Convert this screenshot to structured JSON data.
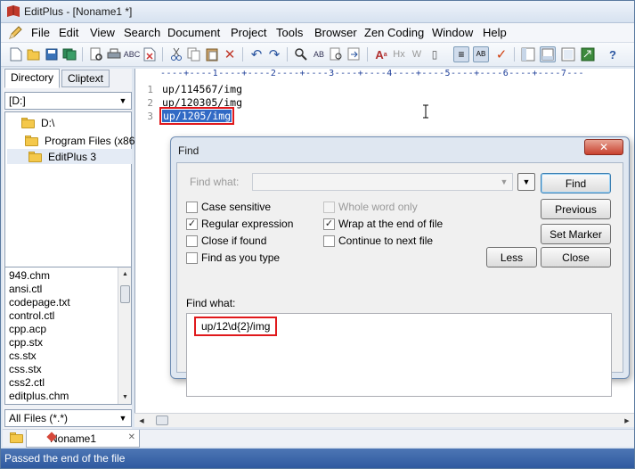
{
  "window": {
    "title": "EditPlus - [Noname1 *]"
  },
  "menu": [
    "File",
    "Edit",
    "View",
    "Search",
    "Document",
    "Project",
    "Tools",
    "Browser",
    "Zen Coding",
    "Window",
    "Help"
  ],
  "toolbar": {
    "icons": [
      "new-icon",
      "open-icon",
      "save-icon",
      "save-all-icon",
      "print-preview-icon",
      "print-icon",
      "spell-check-icon",
      "close-doc-icon",
      "cut-icon",
      "copy-icon",
      "paste-icon",
      "delete-icon",
      "undo-icon",
      "redo-icon",
      "find-icon",
      "replace-icon",
      "find-in-files-icon",
      "go-to-icon",
      "font-icon",
      "hex-icon",
      "word-wrap-icon",
      "column-select-icon",
      "line-number-icon",
      "check-icon",
      "directory-window-icon",
      "output-window-icon",
      "full-screen-icon",
      "browser-icon",
      "help-icon"
    ]
  },
  "left_pane": {
    "tabs": [
      "Directory",
      "Cliptext"
    ],
    "drive": "[D:]",
    "tree": [
      "D:\\",
      "Program Files (x86)",
      "EditPlus 3"
    ],
    "files": [
      "949.chm",
      "ansi.ctl",
      "codepage.txt",
      "control.ctl",
      "cpp.acp",
      "cpp.stx",
      "cs.stx",
      "css.stx",
      "css2.ctl",
      "editplus.chm"
    ],
    "filter": "All Files (*.*)"
  },
  "editor": {
    "ruler": "----+----1----+----2----+----3----+----4----+----5----+----6----+----7---",
    "lines": [
      {
        "num": "1",
        "text": "up/114567/img"
      },
      {
        "num": "2",
        "text": "up/120305/img"
      },
      {
        "num": "3",
        "text": "up/1205/img"
      }
    ]
  },
  "doc_tab": {
    "label": "Noname1",
    "close": "✕"
  },
  "status": {
    "message": "Passed the end of the file"
  },
  "find_dialog": {
    "title": "Find",
    "close": "✕",
    "find_what_label_disabled": "Find what:",
    "options_left": [
      {
        "label": "Case sensitive",
        "checked": false
      },
      {
        "label": "Regular expression",
        "checked": true
      },
      {
        "label": "Close if found",
        "checked": false
      },
      {
        "label": "Find as you type",
        "checked": false
      }
    ],
    "options_right": [
      {
        "label": "Whole word only",
        "checked": false,
        "disabled": true
      },
      {
        "label": "Wrap at the end of file",
        "checked": true
      },
      {
        "label": "Continue to next file",
        "checked": false
      }
    ],
    "buttons": {
      "find": "Find",
      "previous": "Previous",
      "set_marker": "Set Marker",
      "less": "Less",
      "close": "Close"
    },
    "find_what_label": "Find what:",
    "find_what_value": "up/12\\d{2}/img"
  }
}
